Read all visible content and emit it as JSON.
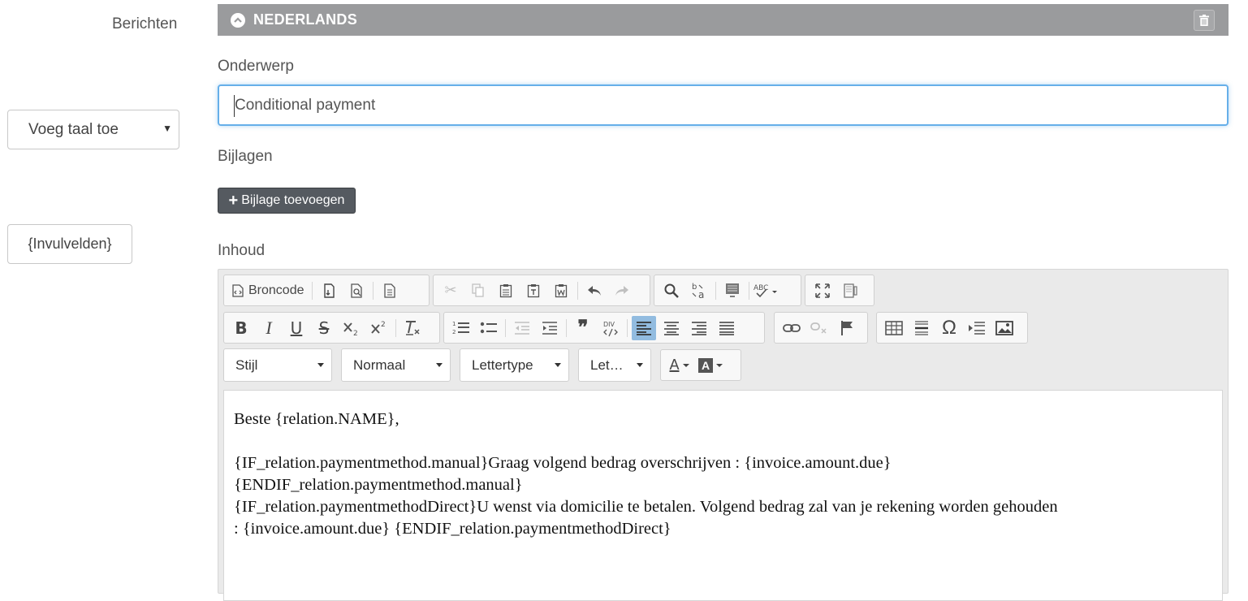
{
  "sidebar": {
    "messages_label": "Berichten",
    "add_language_label": "Voeg taal toe",
    "fill_fields_label": "{Invulvelden}"
  },
  "section": {
    "title": "NEDERLANDS"
  },
  "form": {
    "subject_label": "Onderwerp",
    "subject_value": "Conditional payment",
    "attachments_label": "Bijlagen",
    "add_attachment_label": "Bijlage toevoegen",
    "content_label": "Inhoud"
  },
  "toolbar": {
    "source_label": "Broncode",
    "style_label": "Stijl",
    "format_label": "Normaal",
    "font_label": "Lettertype",
    "size_label": "Let…",
    "text_color_letter": "A",
    "bg_color_letter": "A",
    "bold_glyph": "B",
    "italic_glyph": "I",
    "underline_glyph": "U",
    "strike_glyph": "S",
    "omega_glyph": "Ω",
    "quote_glyph": "❞"
  },
  "content": {
    "lines": [
      "Beste {relation.NAME},",
      "",
      "{IF_relation.paymentmethod.manual}Graag volgend bedrag overschrijven : {invoice.amount.due}",
      "{ENDIF_relation.paymentmethod.manual}",
      "{IF_relation.paymentmethodDirect}U wenst via domicilie te betalen. Volgend bedrag zal van je rekening worden gehouden",
      ": {invoice.amount.due} {ENDIF_relation.paymentmethodDirect}"
    ]
  },
  "colors": {
    "section_bar": "#9a9b9d",
    "focus_border": "#66afe9",
    "button_dark": "#555a60",
    "active_tool": "#92bce0"
  }
}
